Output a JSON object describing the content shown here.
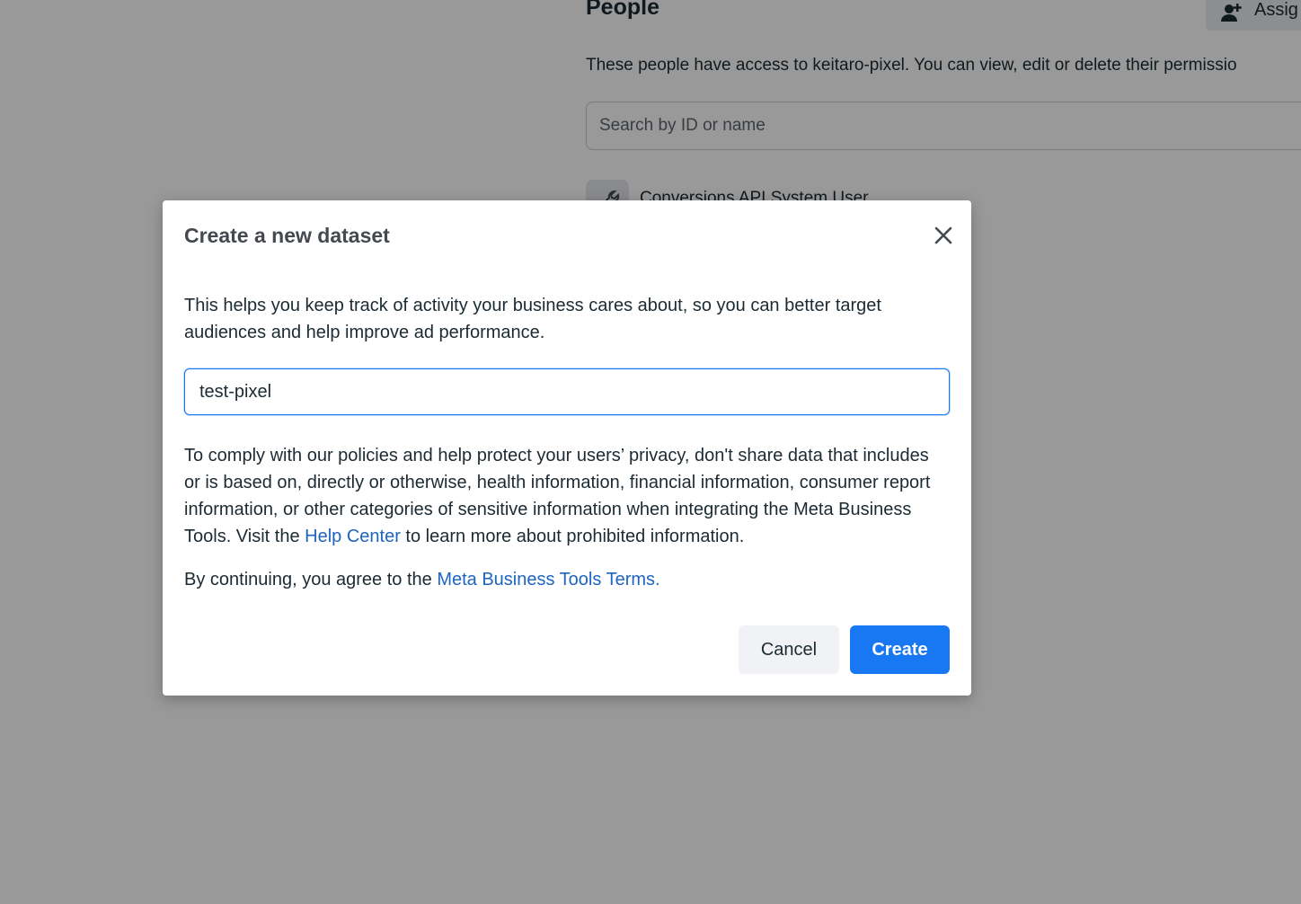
{
  "background": {
    "title": "People",
    "assign_button_label": "Assig",
    "description": "These people have access to keitaro-pixel. You can view, edit or delete their permissio",
    "search_placeholder": "Search by ID or name",
    "user_name": "Conversions API System User"
  },
  "dialog": {
    "title": "Create a new dataset",
    "description": "This helps you keep track of activity your business cares about, so you can better target audiences and help improve ad performance.",
    "name_input_value": "test-pixel",
    "policy_prefix": "To comply with our policies and help protect your users’ privacy, don't share data that includes or is based on, directly or otherwise, health information, financial information, consumer report information, or other categories of sensitive information when integrating the Meta Business Tools. Visit the ",
    "help_center_link": "Help Center",
    "policy_suffix": " to learn more about prohibited information.",
    "terms_prefix": "By continuing, you agree to the ",
    "terms_link": "Meta Business Tools Terms.",
    "cancel_label": "Cancel",
    "create_label": "Create"
  },
  "colors": {
    "primary_blue": "#1877f2",
    "link_blue": "#1d65c1",
    "overlay": "rgba(0,0,0,0.4)"
  },
  "icons": {
    "close": "close-icon",
    "assign": "add-person-icon",
    "user": "wrench-icon"
  }
}
